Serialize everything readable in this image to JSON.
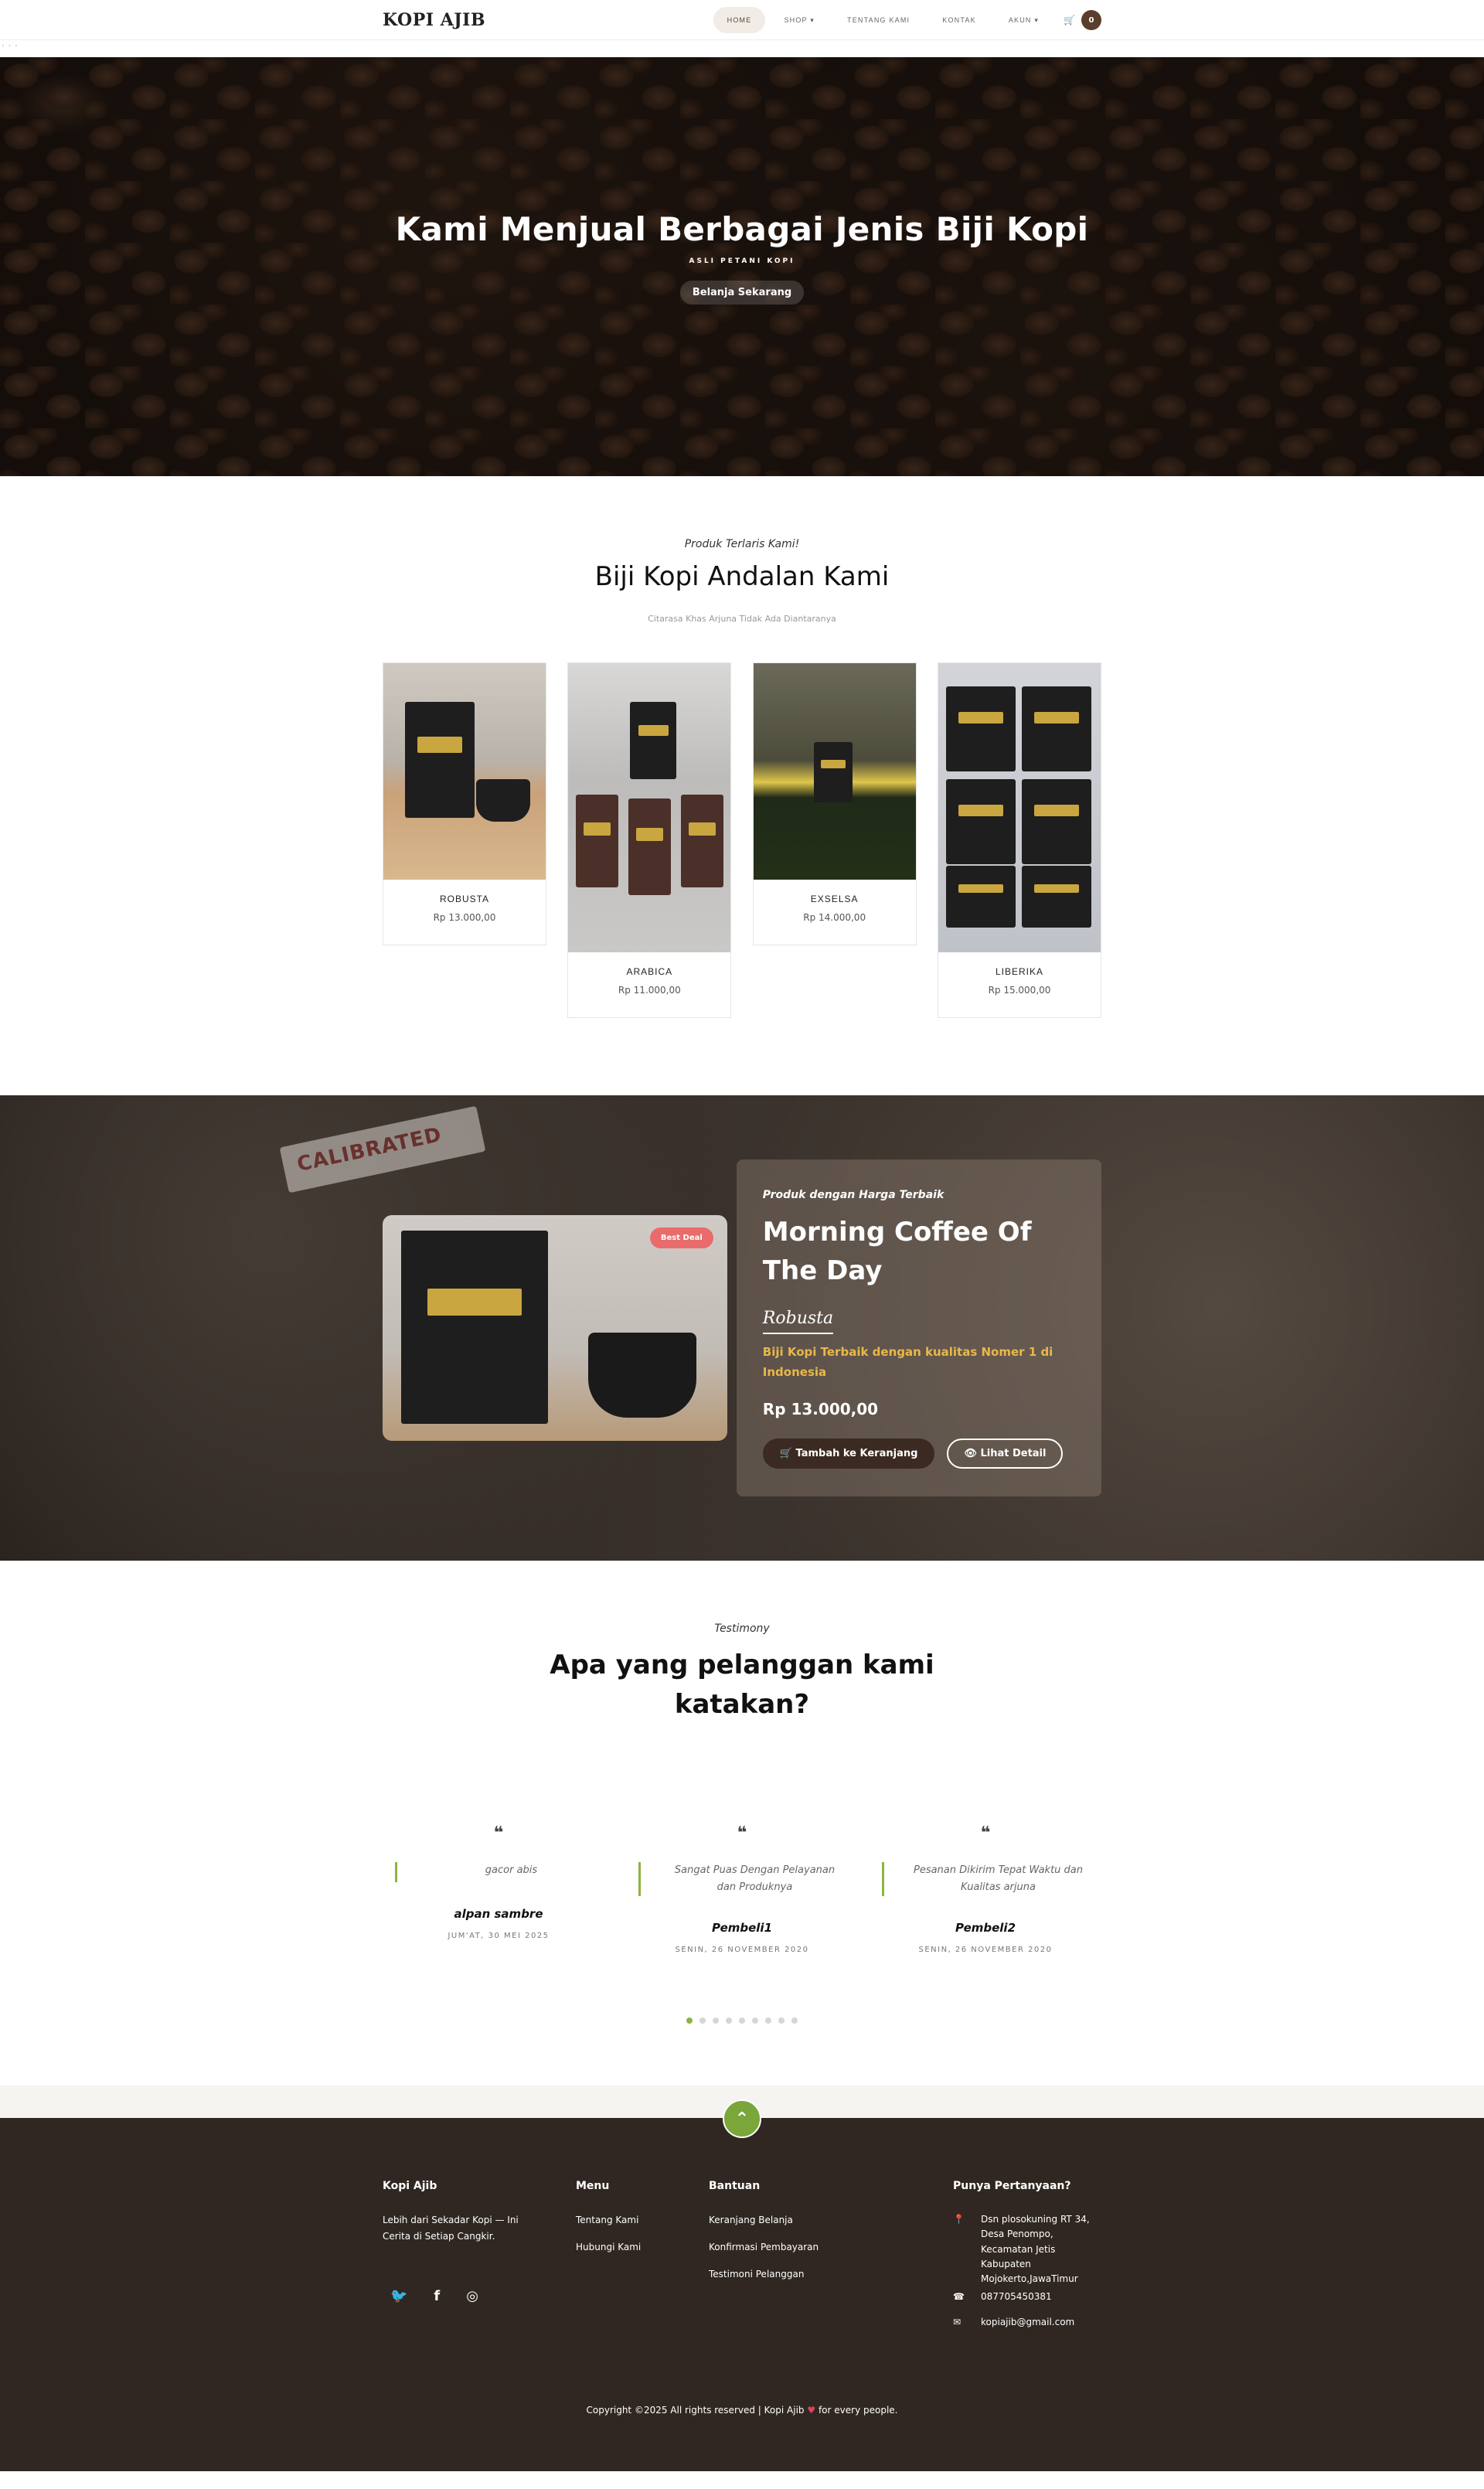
{
  "nav": {
    "brand": "KOPI AJIB",
    "items": [
      "HOME",
      "SHOP ▾",
      "TENTANG KAMI",
      "KONTAK",
      "AKUN ▾"
    ],
    "cart_count": "0"
  },
  "crumb": "‹ › ›",
  "hero": {
    "title": "Kami Menjual Berbagai Jenis Biji Kopi",
    "subtitle": "ASLI PETANI KOPI",
    "button": "Belanja Sekarang"
  },
  "products": {
    "eyebrow": "Produk Terlaris Kami!",
    "title": "Biji Kopi Andalan Kami",
    "description": "Citarasa Khas Arjuna Tidak Ada Diantaranya",
    "items": [
      {
        "name": "ROBUSTA",
        "price": "Rp 13.000,00"
      },
      {
        "name": "ARABICA",
        "price": "Rp 11.000,00"
      },
      {
        "name": "EXSELSA",
        "price": "Rp 14.000,00"
      },
      {
        "name": "LIBERIKA",
        "price": "Rp 15.000,00"
      }
    ]
  },
  "feature": {
    "badge": "Best Deal",
    "eyebrow": "Produk dengan Harga Terbaik",
    "title": "Morning Coffee Of The Day",
    "product": "Robusta",
    "tagline": "Biji Kopi Terbaik dengan kualitas Nomer 1 di Indonesia",
    "price": "Rp 13.000,00",
    "add_to_cart": "🛒 Tambah ke Keranjang",
    "detail": "👁 Lihat Detail",
    "bg_text": "CALIBRATED"
  },
  "testimony": {
    "eyebrow": "Testimony",
    "title": "Apa yang pelanggan kami katakan?",
    "items": [
      {
        "text": "gacor abis",
        "name": "alpan sambre",
        "date": "JUM'AT, 30 MEI 2025"
      },
      {
        "text": "Sangat Puas Dengan Pelayanan dan Produknya",
        "name": "Pembeli1",
        "date": "SENIN, 26 NOVEMBER 2020"
      },
      {
        "text": "Pesanan Dikirim Tepat Waktu dan Kualitas arjuna",
        "name": "Pembeli2",
        "date": "SENIN, 26 NOVEMBER 2020"
      }
    ],
    "dot_count": 9,
    "active_dot": 0
  },
  "footer": {
    "about_title": "Kopi Ajib",
    "about_text": "Lebih dari Sekadar Kopi — Ini Cerita di Setiap Cangkir.",
    "menu_title": "Menu",
    "menu_items": [
      "Tentang Kami",
      "Hubungi Kami"
    ],
    "help_title": "Bantuan",
    "help_items": [
      "Keranjang Belanja",
      "Konfirmasi Pembayaran",
      "Testimoni Pelanggan"
    ],
    "contact_title": "Punya Pertanyaan?",
    "address": "Dsn plosokuning RT 34, Desa Penompo, Kecamatan Jetis Kabupaten Mojokerto,JawaTimur",
    "phone": "087705450381",
    "email": "kopiajib@gmail.com",
    "copyright_pre": "Copyright ©2025 All rights reserved | Kopi Ajib",
    "copyright_post": "for every people.",
    "colors": {
      "accent": "#7aa63a",
      "footer_bg": "#302722",
      "brand_dark": "#5a3e2b"
    }
  }
}
